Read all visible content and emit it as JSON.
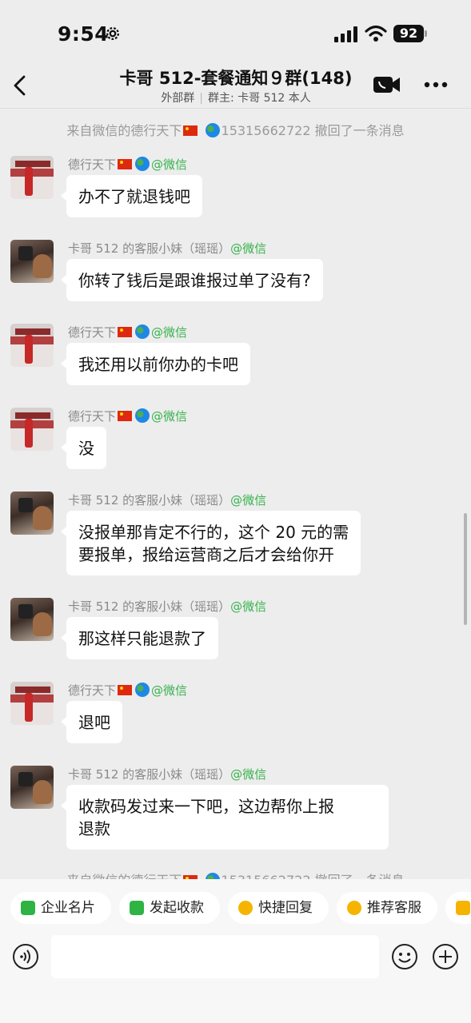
{
  "status_bar": {
    "time": "9:54",
    "battery": "92"
  },
  "header": {
    "title": "卡哥 512-套餐通知９群(148)",
    "group_type": "外部群",
    "owner": "群主: 卡哥 512 本人",
    "icons": [
      "back-icon",
      "video-call-icon",
      "more-icon"
    ]
  },
  "system_messages": [
    {
      "prefix": "来自微信的德行天下",
      "suffix": "15315662722 撤回了一条消息"
    },
    {
      "prefix": "来自微信的德行天下",
      "suffix": "15315662722 撤回了一条消息"
    }
  ],
  "messages": [
    {
      "sender": "德行天下",
      "tag": "@微信",
      "text": "办不了就退钱吧"
    },
    {
      "sender": "卡哥 512 的客服小妹（瑶瑶）",
      "tag": "@微信",
      "text": "你转了钱后是跟谁报过单了没有?"
    },
    {
      "sender": "德行天下",
      "tag": "@微信",
      "text": "我还用以前你办的卡吧"
    },
    {
      "sender": "德行天下",
      "tag": "@微信",
      "text": "没"
    },
    {
      "sender": "卡哥 512 的客服小妹（瑶瑶）",
      "tag": "@微信",
      "line1": "没报单那肯定不行的，这个 20 元的需",
      "line2": "要报单，报给运营商之后才会给你开"
    },
    {
      "sender": "卡哥 512 的客服小妹（瑶瑶）",
      "tag": "@微信",
      "text": "那这样只能退款了"
    },
    {
      "sender": "德行天下",
      "tag": "@微信",
      "text": "退吧"
    },
    {
      "sender": "卡哥 512 的客服小妹（瑶瑶）",
      "tag": "@微信",
      "line1": "收款码发过来一下吧，这边帮你上报",
      "line2": "退款"
    }
  ],
  "quick_actions": [
    {
      "label": "企业名片",
      "color": "#2fb344"
    },
    {
      "label": "发起收款",
      "color": "#2fb344"
    },
    {
      "label": "快捷回复",
      "color": "#f5b400"
    },
    {
      "label": "推荐客服",
      "color": "#f5b400"
    }
  ],
  "input": {
    "placeholder": ""
  }
}
